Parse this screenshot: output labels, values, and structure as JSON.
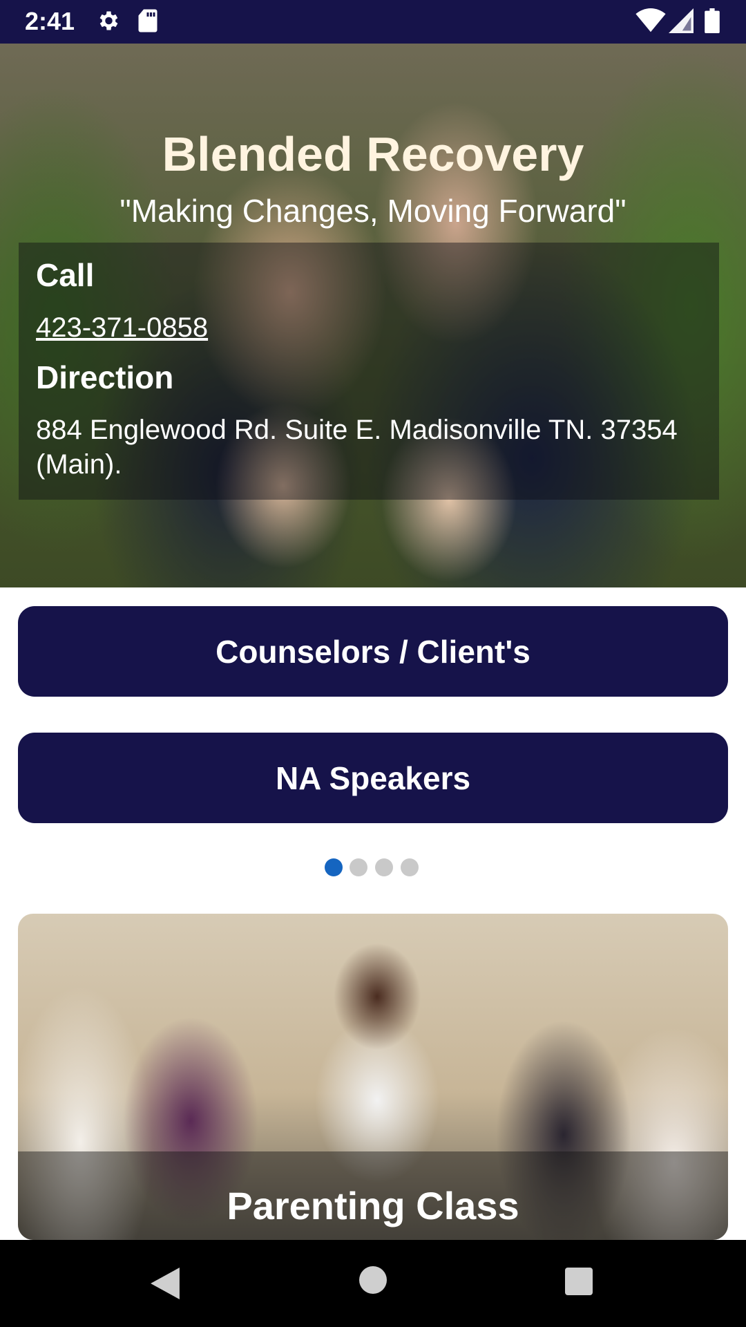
{
  "status_bar": {
    "time": "2:41",
    "icons": [
      "settings-icon",
      "sd-card-icon",
      "wifi-icon",
      "signal-icon",
      "battery-icon"
    ]
  },
  "hero": {
    "title": "Blended Recovery",
    "tagline": "\"Making Changes, Moving Forward\"",
    "call_label": "Call",
    "phone": "423-371-0858",
    "direction_label": "Direction",
    "address": "884 Englewood Rd. Suite E. Madisonville TN. 37354 (Main)."
  },
  "buttons": {
    "counselors": "Counselors / Client's",
    "na_speakers": "NA Speakers"
  },
  "carousel": {
    "caption": "Parenting Class",
    "page_count": 4,
    "active_index": 0
  },
  "colors": {
    "primary": "#16134a",
    "dot_active": "#1565c0",
    "dot_inactive": "#c9c9c9"
  },
  "navigation": {
    "icons": [
      "back-icon",
      "home-icon",
      "recents-icon"
    ]
  }
}
